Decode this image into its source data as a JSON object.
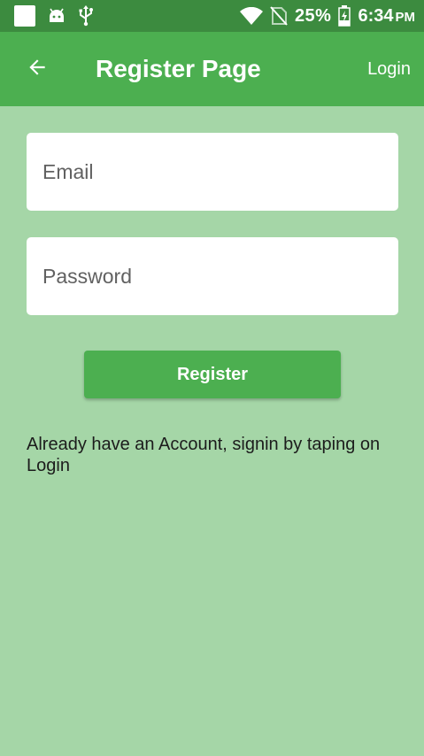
{
  "status_bar": {
    "battery_percent": "25%",
    "time": "6:34",
    "time_suffix": "PM",
    "icons": [
      "notification-square-icon",
      "android-debug-icon",
      "usb-icon",
      "wifi-icon",
      "no-sim-icon",
      "battery-charging-icon"
    ]
  },
  "app_bar": {
    "back_icon": "arrow-left-icon",
    "title": "Register Page",
    "action_label": "Login"
  },
  "form": {
    "email_placeholder": "Email",
    "email_value": "",
    "password_placeholder": "Password",
    "password_value": "",
    "register_label": "Register"
  },
  "info_text": "Already have an Account, signin by taping on Login",
  "colors": {
    "status_bar": "#3c8b3f",
    "app_bar": "#4caf50",
    "background": "#a5d6a7",
    "button": "#4caf50",
    "field": "#ffffff"
  }
}
